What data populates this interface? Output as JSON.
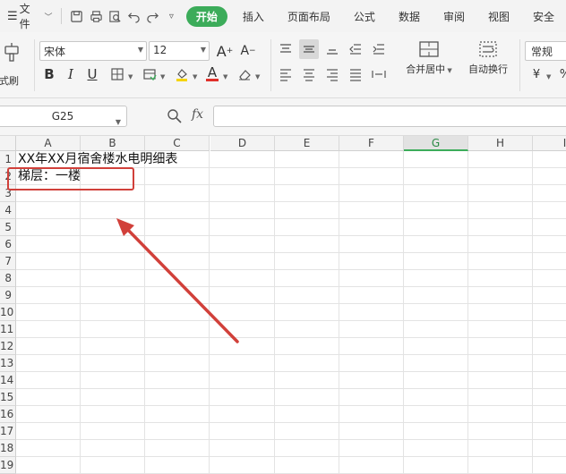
{
  "menubar": {
    "file_label": "文件",
    "tabs": [
      "开始",
      "插入",
      "页面布局",
      "公式",
      "数据",
      "审阅",
      "视图",
      "安全"
    ]
  },
  "ribbon": {
    "format_painter_label": "格式刷",
    "font_name": "宋体",
    "font_size": "12",
    "merge_center_label": "合并居中",
    "wrap_text_label": "自动换行",
    "number_format": "常规",
    "currency_symbol": "¥",
    "percent_symbol": "%"
  },
  "formula_bar": {
    "cell_ref": "G25",
    "fx_label": "fx",
    "formula_value": ""
  },
  "sheet": {
    "columns": [
      "A",
      "B",
      "C",
      "D",
      "E",
      "F",
      "G",
      "H",
      "I"
    ],
    "selected_column": "G",
    "rows": [
      "1",
      "2",
      "3",
      "4",
      "5",
      "6",
      "7",
      "8",
      "9",
      "10",
      "11",
      "12",
      "13",
      "14",
      "15",
      "16",
      "17",
      "18",
      "19"
    ],
    "cells": {
      "A1": "XX年XX月宿舍楼水电明细表",
      "A2": "梯层：一楼"
    }
  },
  "annotation": {
    "box_color": "#d1403a",
    "arrow_color": "#d1403a"
  },
  "colors": {
    "accent": "#3cac5a",
    "font_color_bar": "#e0302a",
    "fill_color_bar": "#f5d400"
  }
}
